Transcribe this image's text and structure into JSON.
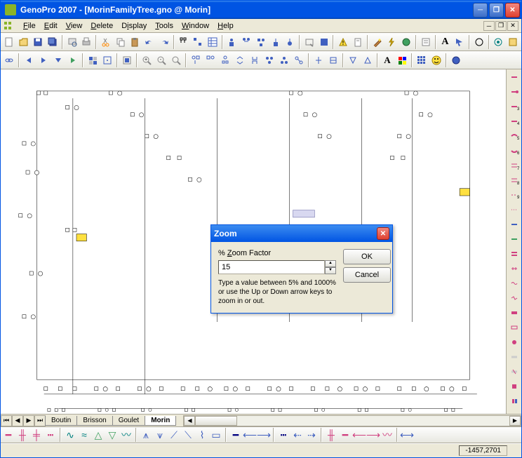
{
  "window": {
    "title": "GenoPro 2007 - [MorinFamilyTree.gno @ Morin]"
  },
  "menu": {
    "items": [
      "File",
      "Edit",
      "View",
      "Delete",
      "Display",
      "Tools",
      "Window",
      "Help"
    ]
  },
  "tabs": {
    "items": [
      "Boutin",
      "Brisson",
      "Goulet",
      "Morin"
    ],
    "active": 3
  },
  "dialog": {
    "title": "Zoom",
    "label": "% Zoom Factor",
    "value": "15",
    "help": "Type a value between 5% and 1000% or use the Up or Down arrow keys to zoom in or out.",
    "ok": "OK",
    "cancel": "Cancel"
  },
  "status": {
    "coords": "-1457,2701"
  }
}
